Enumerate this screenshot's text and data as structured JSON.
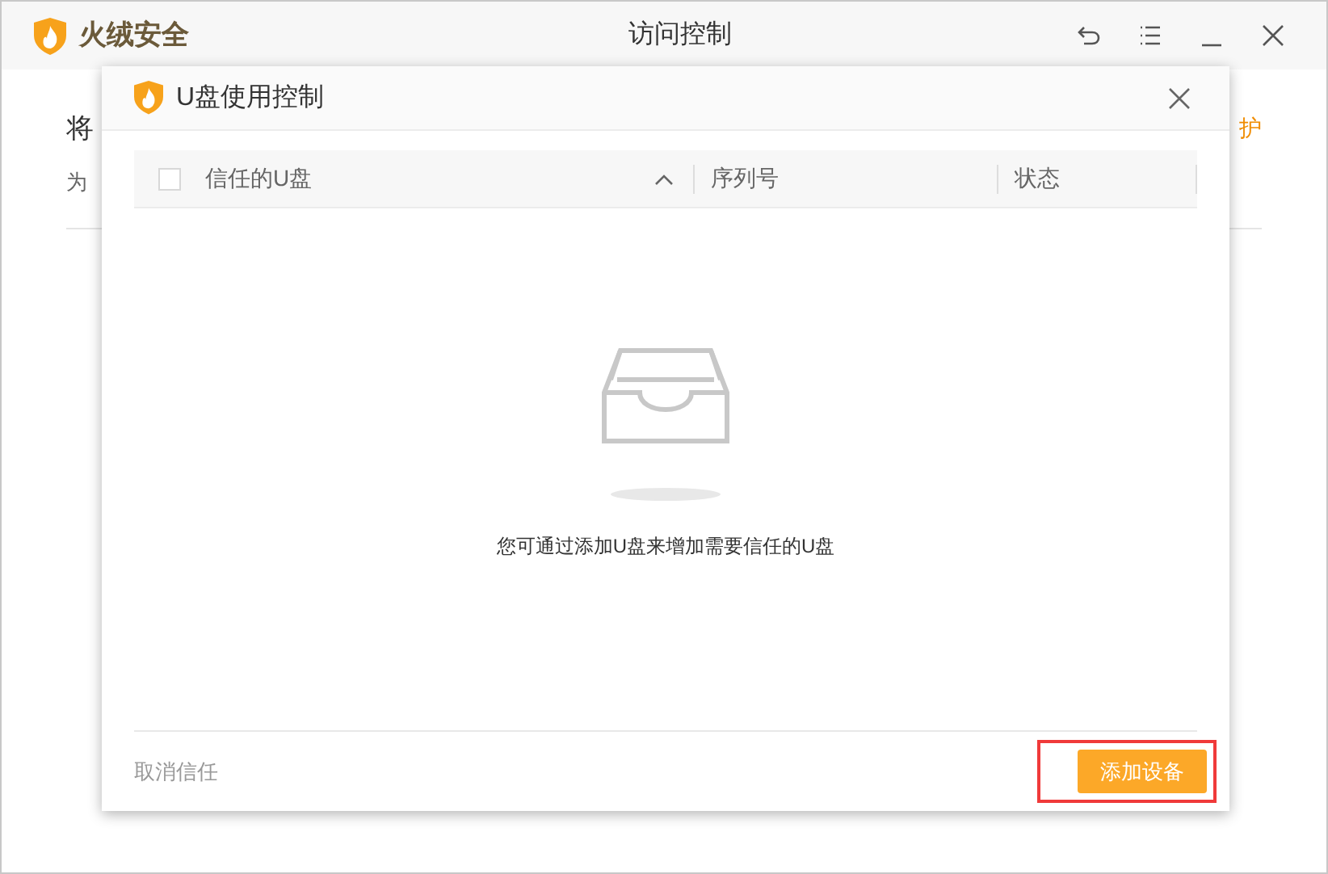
{
  "window": {
    "app_name": "火绒安全",
    "title": "访问控制",
    "controls": [
      {
        "kind": "back"
      },
      {
        "kind": "menu"
      },
      {
        "kind": "minimize"
      },
      {
        "kind": "close"
      }
    ]
  },
  "background": {
    "heading": "将",
    "subtext": "为",
    "link": "护"
  },
  "dialog": {
    "title": "U盘使用控制",
    "table": {
      "select_all": {
        "checked": false
      },
      "columns": [
        {
          "label": "信任的U盘",
          "sorted": true
        },
        {
          "label": "序列号",
          "sorted": false
        },
        {
          "label": "状态",
          "sorted": false
        }
      ]
    },
    "empty_message": "您可通过添加U盘来增加需要信任的U盘",
    "footer": {
      "secondary": {
        "label": "取消信任",
        "disabled": true
      },
      "primary": {
        "label": "添加设备",
        "highlighted": true
      }
    }
  }
}
